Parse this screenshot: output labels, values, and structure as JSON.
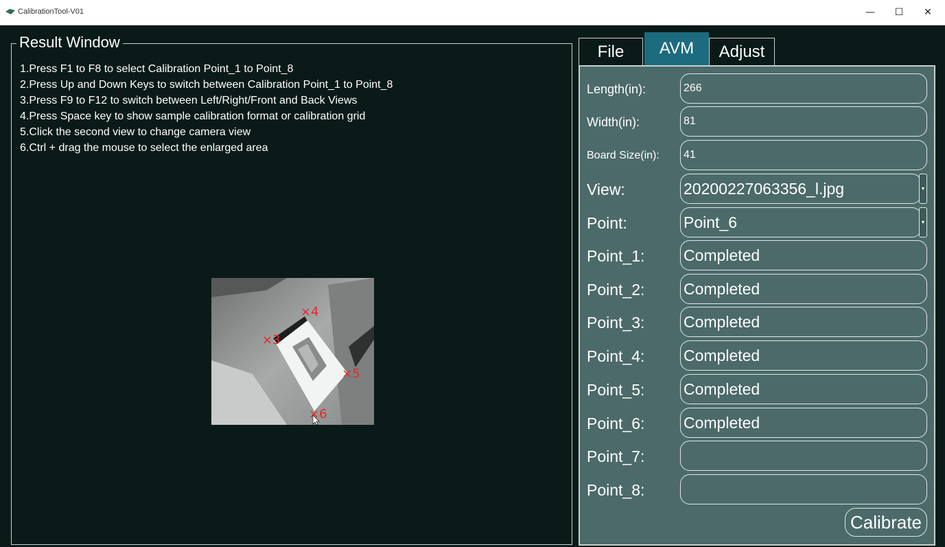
{
  "window": {
    "title": "CalibrationTool-V01",
    "minimize": "—",
    "maximize": "☐",
    "close": "✕"
  },
  "result": {
    "title": "Result Window",
    "instructions": [
      "1.Press F1 to F8 to select Calibration Point_1 to Point_8",
      "2.Press Up and Down Keys to switch between Calibration Point_1 to Point_8",
      "3.Press F9 to F12 to switch between Left/Right/Front and Back Views",
      "4.Press Space key to show sample calibration format or calibration grid",
      "5.Click the second view to change camera view",
      "6.Ctrl + drag the mouse to select the enlarged area"
    ],
    "preview_points": [
      "3",
      "4",
      "5",
      "6"
    ]
  },
  "tabs": {
    "file": "File",
    "avm": "AVM",
    "adjust": "Adjust",
    "active": "AVM"
  },
  "avm": {
    "length_label": "Length(in):",
    "length_value": "266",
    "width_label": "Width(in):",
    "width_value": "81",
    "board_label": "Board Size(in):",
    "board_value": "41",
    "view_label": "View:",
    "view_value": "20200227063356_l.jpg",
    "point_label": "Point:",
    "point_value": "Point_6",
    "points": [
      {
        "label": "Point_1:",
        "value": "Completed"
      },
      {
        "label": "Point_2:",
        "value": "Completed"
      },
      {
        "label": "Point_3:",
        "value": "Completed"
      },
      {
        "label": "Point_4:",
        "value": "Completed"
      },
      {
        "label": "Point_5:",
        "value": "Completed"
      },
      {
        "label": "Point_6:",
        "value": "Completed"
      },
      {
        "label": "Point_7:",
        "value": ""
      },
      {
        "label": "Point_8:",
        "value": ""
      }
    ],
    "calibrate_label": "Calibrate"
  },
  "colors": {
    "background": "#0a1a18",
    "panel": "#4c6a6a",
    "active_tab": "#1d6b7e",
    "marker": "#e8262a"
  }
}
